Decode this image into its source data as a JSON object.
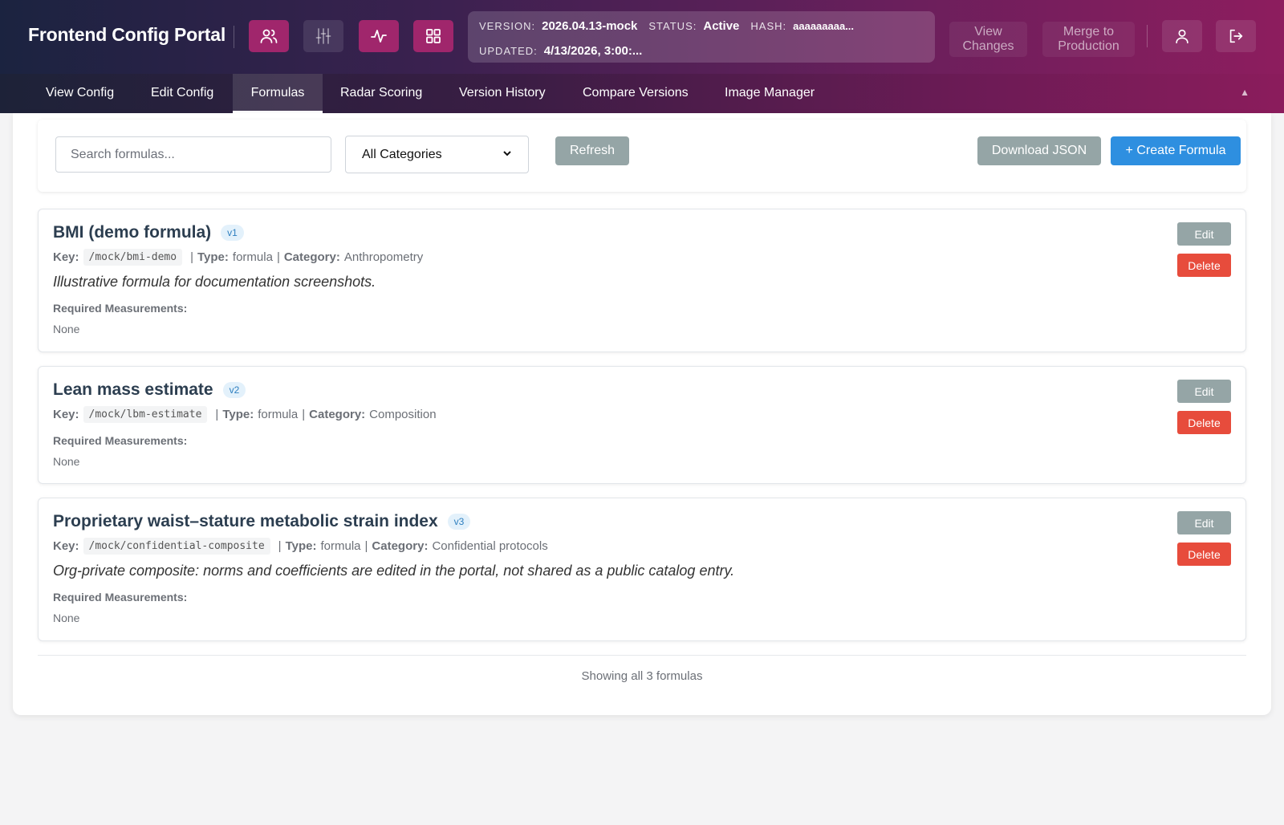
{
  "header": {
    "app_title": "Frontend Config Portal",
    "icon_buttons": [
      {
        "icon": "users-icon",
        "state": "active"
      },
      {
        "icon": "sliders-icon",
        "state": "inactive"
      },
      {
        "icon": "activity-icon",
        "state": "active"
      },
      {
        "icon": "grid-icon",
        "state": "active"
      }
    ],
    "info": {
      "version_label": "VERSION:",
      "version_value": "2026.04.13-mock",
      "status_label": "STATUS:",
      "status_value": "Active",
      "hash_label": "HASH:",
      "hash_value": "aaaaaaaaa...",
      "updated_label": "UPDATED:",
      "updated_value": "4/13/2026, 3:00:..."
    },
    "view_changes_label": "View\nChanges",
    "merge_label": "Merge to\nProduction",
    "user_icon": "user-icon",
    "logout_icon": "logout-icon"
  },
  "tabs": [
    {
      "label": "View Config",
      "active": false
    },
    {
      "label": "Edit Config",
      "active": false
    },
    {
      "label": "Formulas",
      "active": true
    },
    {
      "label": "Radar Scoring",
      "active": false
    },
    {
      "label": "Version History",
      "active": false
    },
    {
      "label": "Compare Versions",
      "active": false
    },
    {
      "label": "Image Manager",
      "active": false
    }
  ],
  "collapse_glyph": "▲",
  "toolbar": {
    "search_placeholder": "Search formulas...",
    "category_selected": "All Categories",
    "refresh_label": "Refresh",
    "download_label": "Download JSON",
    "create_label": "+ Create Formula"
  },
  "labels": {
    "key": "Key:",
    "type": "Type:",
    "category": "Category:",
    "required": "Required Measurements:",
    "edit": "Edit",
    "delete": "Delete"
  },
  "formulas": [
    {
      "title": "BMI (demo formula)",
      "version": "v1",
      "key": "/mock/bmi-demo",
      "type": "formula",
      "category": "Anthropometry",
      "description": "Illustrative formula for documentation screenshots.",
      "required": "None"
    },
    {
      "title": "Lean mass estimate",
      "version": "v2",
      "key": "/mock/lbm-estimate",
      "type": "formula",
      "category": "Composition",
      "description": "",
      "required": "None"
    },
    {
      "title": "Proprietary waist–stature metabolic strain index",
      "version": "v3",
      "key": "/mock/confidential-composite",
      "type": "formula",
      "category": "Confidential protocols",
      "description": "Org-private composite: norms and coefficients are edited in the portal, not shared as a public catalog entry.",
      "required": "None"
    }
  ],
  "footer_text": "Showing all 3 formulas"
}
